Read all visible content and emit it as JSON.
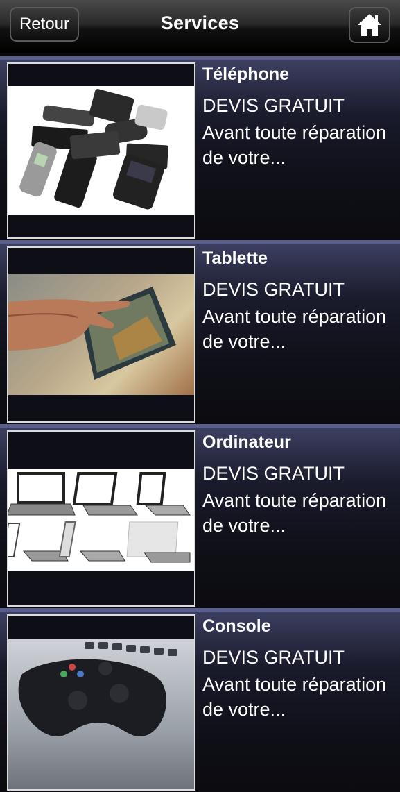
{
  "header": {
    "title": "Services",
    "back_label": "Retour",
    "home_icon": "home-icon"
  },
  "services": [
    {
      "title": "Téléphone",
      "devis": "DEVIS GRATUIT",
      "desc": "Avant toute réparation de votre...",
      "image": "phones-pile"
    },
    {
      "title": "Tablette",
      "devis": "DEVIS GRATUIT",
      "desc": "Avant toute réparation de votre...",
      "image": "hand-on-tablet"
    },
    {
      "title": "Ordinateur",
      "devis": "DEVIS GRATUIT",
      "desc": "Avant toute réparation de votre...",
      "image": "laptops-grid"
    },
    {
      "title": "Console",
      "devis": "DEVIS GRATUIT",
      "desc": "Avant toute réparation de votre...",
      "image": "game-controller"
    }
  ],
  "colors": {
    "row_highlight": "#5a5e8a",
    "background": "#0a0a0e",
    "text": "#ffffff"
  }
}
